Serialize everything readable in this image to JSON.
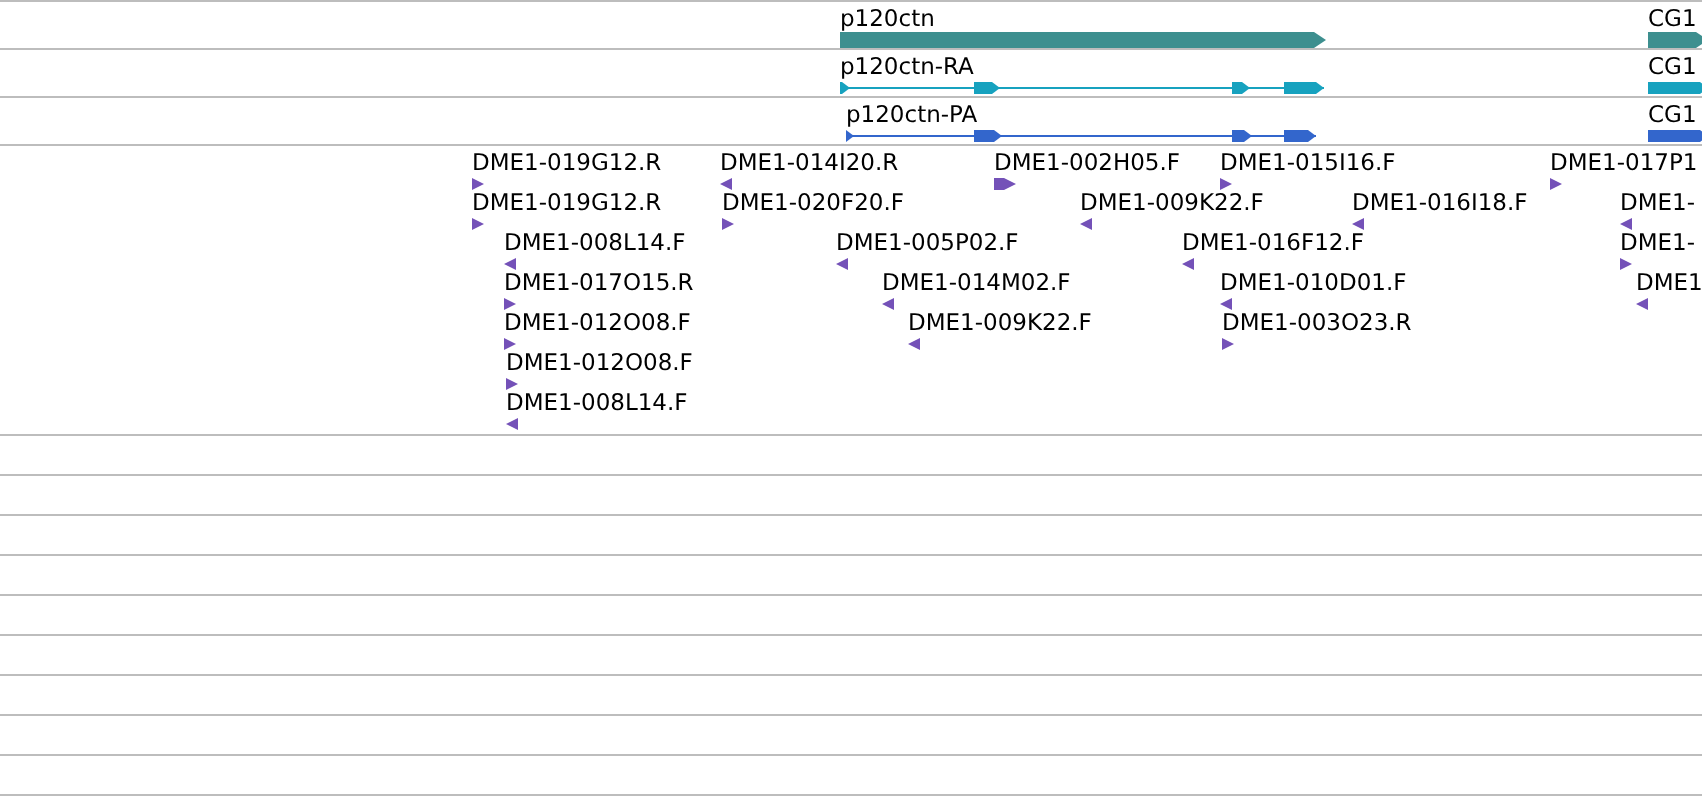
{
  "tracks": [
    {
      "kind": "gene",
      "color": "#3d8f8f",
      "items": [
        {
          "label": "p120ctn"
        },
        {
          "label": "CG1"
        }
      ]
    },
    {
      "kind": "transcript",
      "color": "#17a2bf",
      "items": [
        {
          "label": "p120ctn-RA"
        },
        {
          "label": "CG1"
        }
      ]
    },
    {
      "kind": "transcript",
      "color": "#3366cc",
      "items": [
        {
          "label": "p120ctn-PA"
        },
        {
          "label": "CG1"
        }
      ]
    }
  ],
  "features": [
    {
      "label": "DME1-019G12.R",
      "reverse": false
    },
    {
      "label": "DME1-014I20.R",
      "reverse": true
    },
    {
      "label": "DME1-002H05.F",
      "reverse": false
    },
    {
      "label": "DME1-015I16.F",
      "reverse": false
    },
    {
      "label": "DME1-017P1",
      "reverse": false
    },
    {
      "label": "DME1-019G12.R",
      "reverse": false
    },
    {
      "label": "DME1-020F20.F",
      "reverse": false
    },
    {
      "label": "DME1-009K22.F",
      "reverse": true
    },
    {
      "label": "DME1-016I18.F",
      "reverse": true
    },
    {
      "label": "DME1-",
      "reverse": true
    },
    {
      "label": "DME1-008L14.F",
      "reverse": true
    },
    {
      "label": "DME1-005P02.F",
      "reverse": true
    },
    {
      "label": "DME1-016F12.F",
      "reverse": true
    },
    {
      "label": "DME1-",
      "reverse": false
    },
    {
      "label": "DME1-017O15.R",
      "reverse": false
    },
    {
      "label": "DME1-014M02.F",
      "reverse": true
    },
    {
      "label": "DME1-010D01.F",
      "reverse": true
    },
    {
      "label": "DME1",
      "reverse": true
    },
    {
      "label": "DME1-012O08.F",
      "reverse": false
    },
    {
      "label": "DME1-009K22.F",
      "reverse": true
    },
    {
      "label": "DME1-003O23.R",
      "reverse": false
    },
    {
      "label": "DME1-012O08.F",
      "reverse": false
    },
    {
      "label": "DME1-008L14.F",
      "reverse": true
    }
  ]
}
